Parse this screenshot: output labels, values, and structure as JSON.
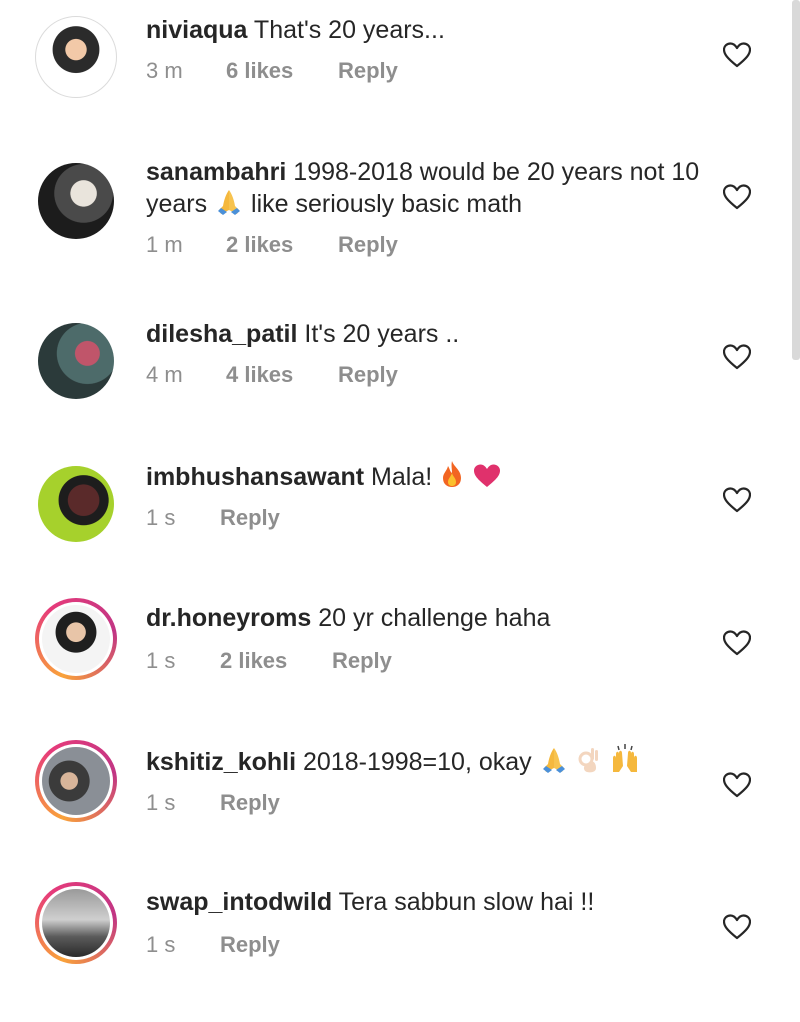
{
  "comments": [
    {
      "username": "niviaqua",
      "text": "That's 20 years...",
      "time": "3 m",
      "likes": "6 likes",
      "reply": "Reply"
    },
    {
      "username": "sanambahri",
      "text": "1998-2018 would be 20 years not 10 years",
      "text_after_emoji": "like seriously basic math",
      "time": "1 m",
      "likes": "2 likes",
      "reply": "Reply"
    },
    {
      "username": "dilesha_patil",
      "text": "It's 20 years ..",
      "time": "4 m",
      "likes": "4 likes",
      "reply": "Reply"
    },
    {
      "username": "imbhushansawant",
      "text": "Mala!",
      "time": "1 s",
      "likes": "",
      "reply": "Reply"
    },
    {
      "username": "dr.honeyroms",
      "text": "20 yr challenge haha",
      "time": "1 s",
      "likes": "2 likes",
      "reply": "Reply"
    },
    {
      "username": "kshitiz_kohli",
      "text": "2018-1998=10, okay",
      "time": "1 s",
      "likes": "",
      "reply": "Reply"
    },
    {
      "username": "swap_intodwild",
      "text": "Tera sabbun slow hai !!",
      "time": "1 s",
      "likes": "",
      "reply": "Reply"
    }
  ],
  "icons": {
    "like": "heart-outline-icon",
    "pray": "folded-hands-emoji",
    "fire": "fire-emoji",
    "heart": "red-heart-emoji",
    "ok": "ok-hand-emoji",
    "raised": "raised-hands-emoji"
  },
  "colors": {
    "text": "#262626",
    "meta": "#8e8e8e",
    "story_ring": "#e1306c"
  }
}
